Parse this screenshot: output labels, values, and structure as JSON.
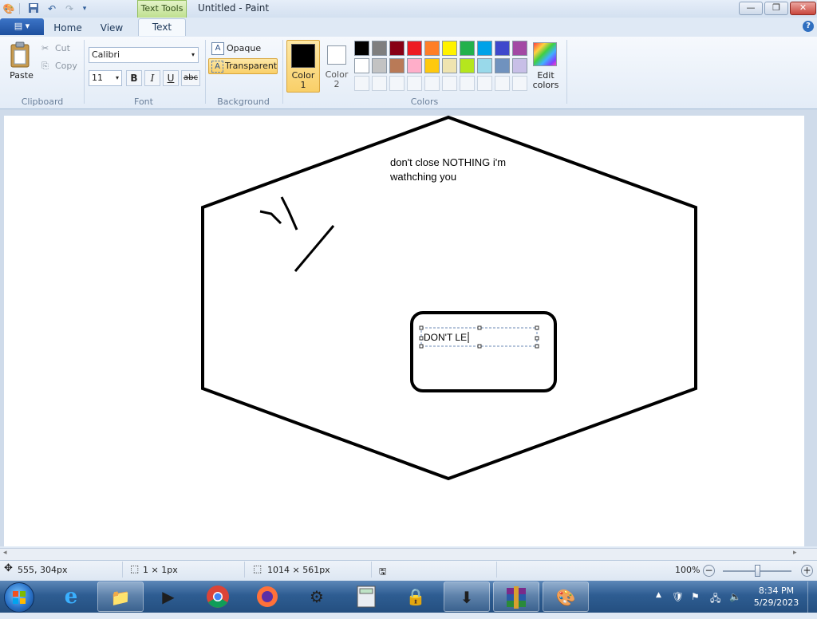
{
  "window": {
    "title": "Untitled - Paint",
    "context_tab": "Text Tools",
    "controls": {
      "minimize": "—",
      "maximize": "❐",
      "close": "✕"
    }
  },
  "qat": {
    "save_icon": "save-icon",
    "undo_icon": "undo-icon",
    "redo_icon": "redo-icon",
    "customize_icon": "chevron-down-icon"
  },
  "tabs": {
    "menu": "▤ ▾",
    "home": "Home",
    "view": "View",
    "text": "Text"
  },
  "ribbon": {
    "clipboard": {
      "paste": "Paste",
      "cut": "Cut",
      "copy": "Copy",
      "group": "Clipboard"
    },
    "font": {
      "family": "Calibri",
      "size": "11",
      "bold": "B",
      "italic": "I",
      "underline": "U",
      "strike": "abc",
      "group": "Font"
    },
    "background": {
      "opaque": "Opaque",
      "transparent": "Transparent",
      "group": "Background"
    },
    "colors": {
      "color1": "Color\n1",
      "color1_label": "Color",
      "color1_num": "1",
      "color2_label": "Color",
      "color2_num": "2",
      "edit": "Edit",
      "edit2": "colors",
      "group": "Colors",
      "color1_value": "#000000",
      "color2_value": "#ffffff",
      "row1": [
        "#000000",
        "#7f7f7f",
        "#880015",
        "#ed1c24",
        "#ff7f27",
        "#fff200",
        "#22b14c",
        "#00a2e8",
        "#3f48cc",
        "#a349a4"
      ],
      "row2": [
        "#ffffff",
        "#c3c3c3",
        "#b97a57",
        "#ffaec9",
        "#ffc90e",
        "#efe4b0",
        "#b5e61d",
        "#99d9ea",
        "#7092be",
        "#c8bfe7"
      ]
    }
  },
  "canvas": {
    "note_line1": "don't close NOTHING i'm",
    "note_line2": "wathching you",
    "textbox": "DON'T LE"
  },
  "status": {
    "cursor": "555, 304px",
    "selection": "1 × 1px",
    "canvas_size": "1014 × 561px",
    "zoom": "100%",
    "zoom_minus": "−",
    "zoom_plus": "+"
  },
  "taskbar": {
    "time": "8:34 PM",
    "date": "5/29/2023"
  }
}
